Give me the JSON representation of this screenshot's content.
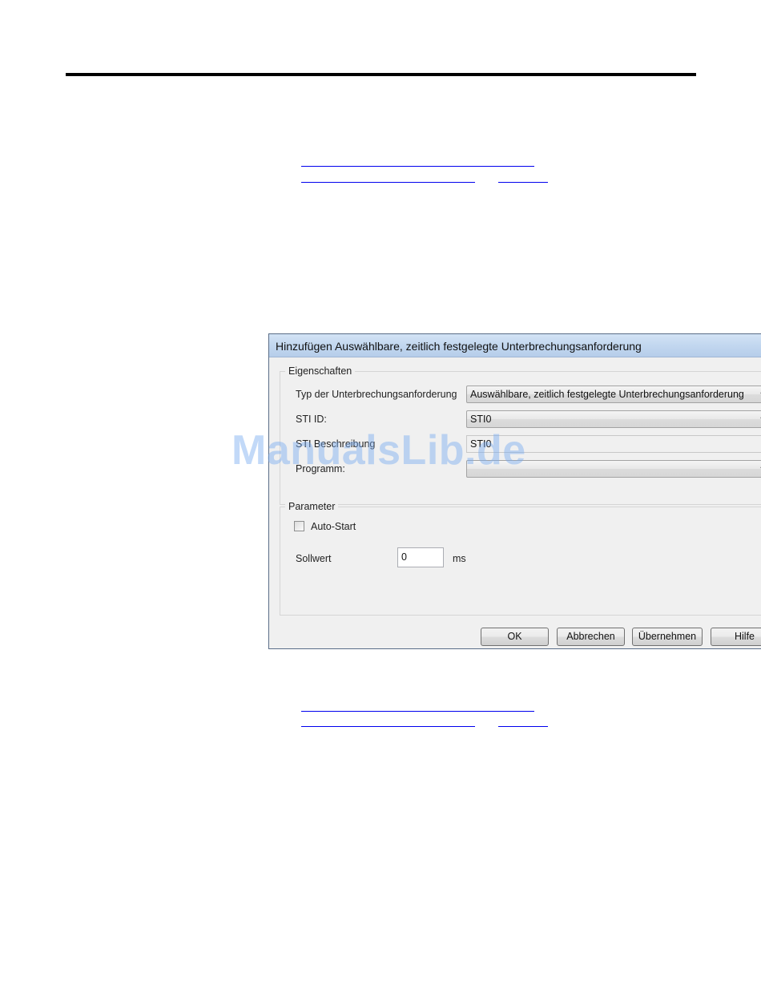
{
  "dialog": {
    "title": "Hinzufügen Auswählbare, zeitlich festgelegte Unterbrechungsanforderung",
    "eigenschaften": {
      "group_label": "Eigenschaften",
      "type_label": "Typ der Unterbrechungsanforderung",
      "type_value": "Auswählbare, zeitlich festgelegte Unterbrechungsanforderung",
      "sti_id_label": "STI ID:",
      "sti_id_value": "STI0",
      "sti_desc_label": "STI Beschreibung",
      "sti_desc_value": "STI0",
      "program_label": "Programm:",
      "program_value": ""
    },
    "parameter": {
      "group_label": "Parameter",
      "autostart_label": "Auto-Start",
      "autostart_checked": false,
      "sollwert_label": "Sollwert",
      "sollwert_value": "0",
      "sollwert_unit": "ms"
    },
    "buttons": {
      "ok": "OK",
      "cancel": "Abbrechen",
      "apply": "Übernehmen",
      "help": "Hilfe"
    }
  },
  "icons": {
    "dropdown": "chevron-down-icon"
  },
  "colors": {
    "titlebar": "#c2d7ef",
    "dialog_bg": "#f0f0f0",
    "link": "#0000ee",
    "watermark": "#78aaf0"
  },
  "watermark": "ManualsLib.de"
}
